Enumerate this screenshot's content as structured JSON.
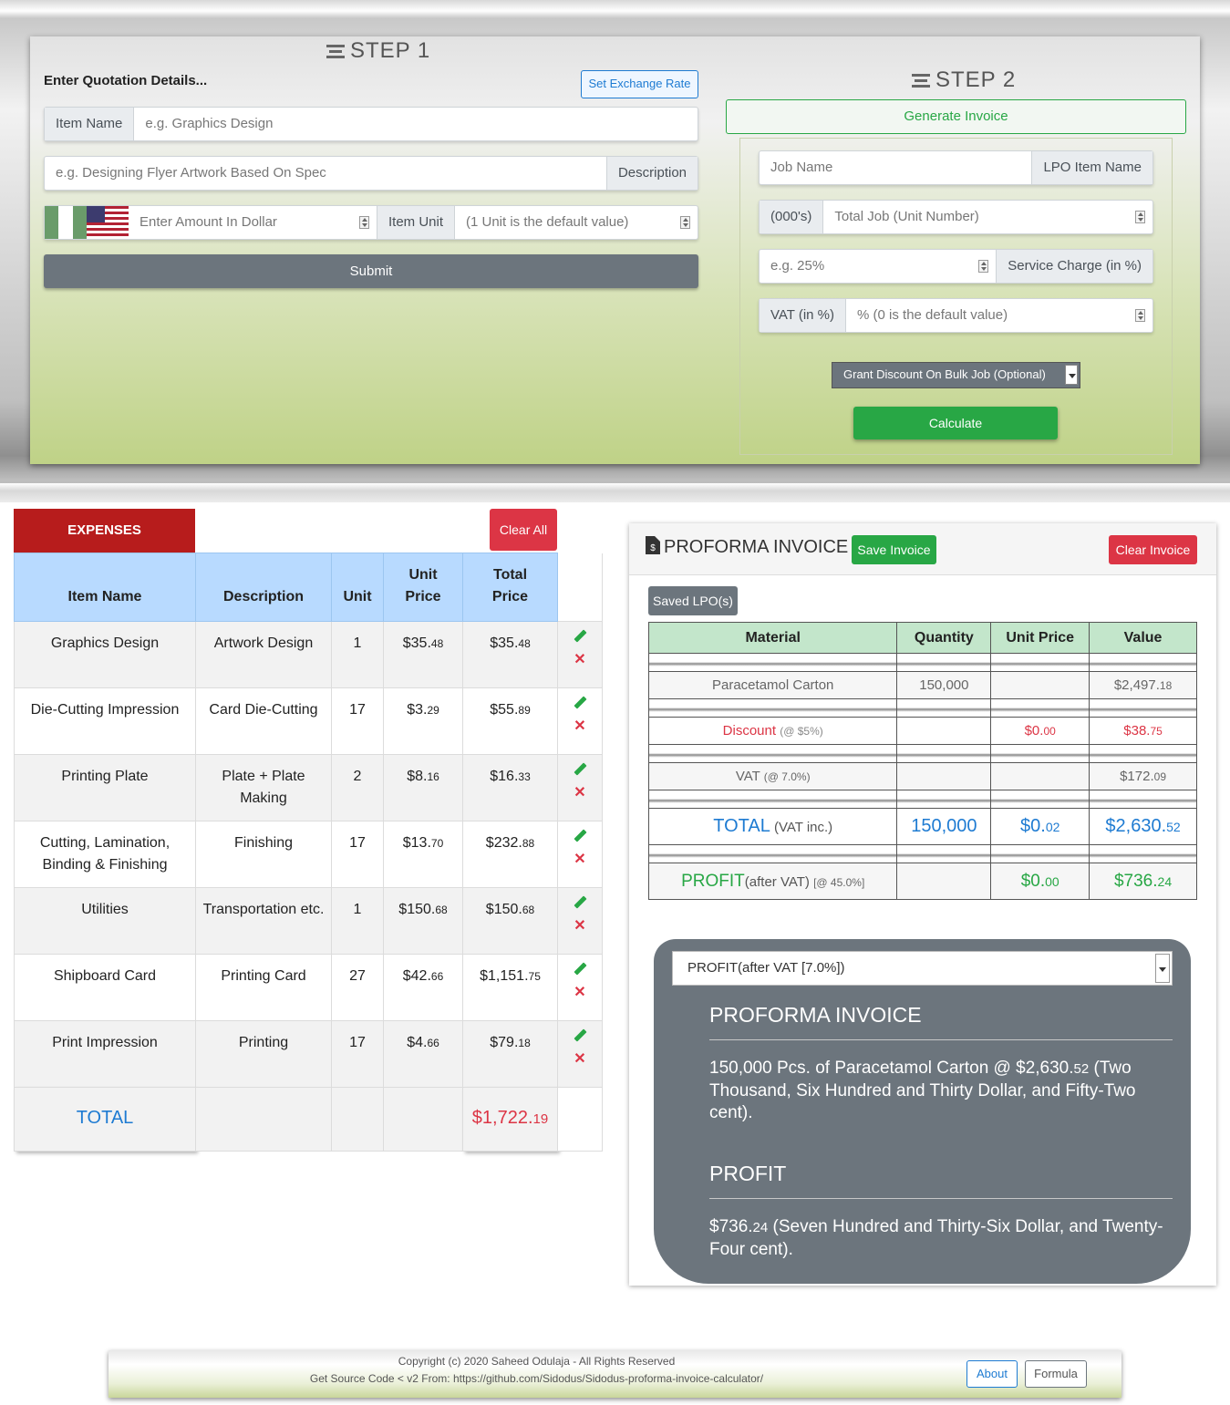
{
  "step1": {
    "title": "STEP 1",
    "heading": "Enter Quotation Details...",
    "exchange_button": "Set Exchange Rate",
    "item_name_label": "Item Name",
    "item_name_placeholder": "e.g. Graphics Design",
    "description_placeholder": "e.g. Designing Flyer Artwork Based On Spec",
    "description_label": "Description",
    "amount_placeholder": "Enter Amount In Dollar",
    "item_unit_label": "Item Unit",
    "item_unit_placeholder": "(1 Unit is the default value)",
    "submit": "Submit"
  },
  "step2": {
    "title": "STEP 2",
    "generate_button": "Generate Invoice",
    "job_name_placeholder": "Job Name",
    "lpo_label": "LPO Item Name",
    "thousands_label": "(000's)",
    "total_job_placeholder": "Total Job (Unit Number)",
    "service_placeholder": "e.g. 25%",
    "service_label": "Service Charge (in %)",
    "vat_label": "VAT (in %)",
    "vat_placeholder": "% (0 is the default value)",
    "discount_select": "Grant Discount On Bulk Job (Optional)",
    "calculate": "Calculate"
  },
  "expenses": {
    "title": "EXPENSES",
    "clear_all": "Clear All",
    "headers": [
      "Item Name",
      "Description",
      "Unit",
      "Unit Price",
      "Total Price"
    ],
    "rows": [
      {
        "name": "Graphics Design",
        "desc": "Artwork Design",
        "unit": "1",
        "up_main": "$35.",
        "up_cents": "48",
        "tp_main": "$35.",
        "tp_cents": "48"
      },
      {
        "name": "Die-Cutting Impression",
        "desc": "Card Die-Cutting",
        "unit": "17",
        "up_main": "$3.",
        "up_cents": "29",
        "tp_main": "$55.",
        "tp_cents": "89"
      },
      {
        "name": "Printing Plate",
        "desc": "Plate + Plate Making",
        "unit": "2",
        "up_main": "$8.",
        "up_cents": "16",
        "tp_main": "$16.",
        "tp_cents": "33"
      },
      {
        "name": "Cutting, Lamination, Binding & Finishing",
        "desc": "Finishing",
        "unit": "17",
        "up_main": "$13.",
        "up_cents": "70",
        "tp_main": "$232.",
        "tp_cents": "88"
      },
      {
        "name": "Utilities",
        "desc": "Transportation etc.",
        "unit": "1",
        "up_main": "$150.",
        "up_cents": "68",
        "tp_main": "$150.",
        "tp_cents": "68"
      },
      {
        "name": "Shipboard Card",
        "desc": "Printing Card",
        "unit": "27",
        "up_main": "$42.",
        "up_cents": "66",
        "tp_main": "$1,151.",
        "tp_cents": "75"
      },
      {
        "name": "Print Impression",
        "desc": "Printing",
        "unit": "17",
        "up_main": "$4.",
        "up_cents": "66",
        "tp_main": "$79.",
        "tp_cents": "18"
      }
    ],
    "total_label": "TOTAL",
    "total_main": "$1,722.",
    "total_cents": "19"
  },
  "invoice": {
    "title": "PROFORMA INVOICE",
    "save": "Save Invoice",
    "clear": "Clear Invoice",
    "saved_lpo": "Saved LPO(s)",
    "headers": [
      "Material",
      "Quantity",
      "Unit Price",
      "Value"
    ],
    "item": {
      "name": "Paracetamol Carton",
      "qty": "150,000",
      "value_main": "$2,497.",
      "value_cents": "18"
    },
    "discount": {
      "label": "Discount",
      "note": "(@ $5%)",
      "up_main": "$0.",
      "up_cents": "00",
      "value_main": "$38.",
      "value_cents": "75"
    },
    "vat": {
      "label": "VAT",
      "note": "(@ 7.0%)",
      "value_main": "$172.",
      "value_cents": "09"
    },
    "total": {
      "label": "TOTAL",
      "note": "(VAT inc.)",
      "qty": "150,000",
      "up_main": "$0.",
      "up_cents": "02",
      "value_main": "$2,630.",
      "value_cents": "52"
    },
    "profit": {
      "label": "PROFIT",
      "note": "(after VAT)",
      "note2": "[@ 45.0%]",
      "up_main": "$0.",
      "up_cents": "00",
      "value_main": "$736.",
      "value_cents": "24"
    }
  },
  "summary": {
    "select": "PROFIT(after VAT [7.0%])",
    "h1": "PROFORMA INVOICE",
    "p1_a": "150,000 Pcs. of Paracetamol Carton @ $2,630.",
    "p1_cents": "52",
    "p1_b": " (Two Thousand, Six Hundred and Thirty Dollar, and Fifty-Two cent).",
    "h2": "PROFIT",
    "p2_a": "$736.",
    "p2_cents": "24",
    "p2_b": " (Seven Hundred and Thirty-Six Dollar, and Twenty-Four cent)."
  },
  "footer": {
    "copyright": "Copyright (c) 2020 Saheed Odulaja - All Rights Reserved",
    "source": "Get Source Code < v2 From: https://github.com/Sidodus/Sidodus-proforma-invoice-calculator/",
    "about": "About",
    "formula": "Formula"
  },
  "colors": {
    "green": "#28a745",
    "red": "#dc3545",
    "blue": "#1e7bd2",
    "gray": "#6c757d",
    "expenses_red": "#b71c1c",
    "header_blue": "#b8daff",
    "header_green": "#c3e6cb"
  }
}
